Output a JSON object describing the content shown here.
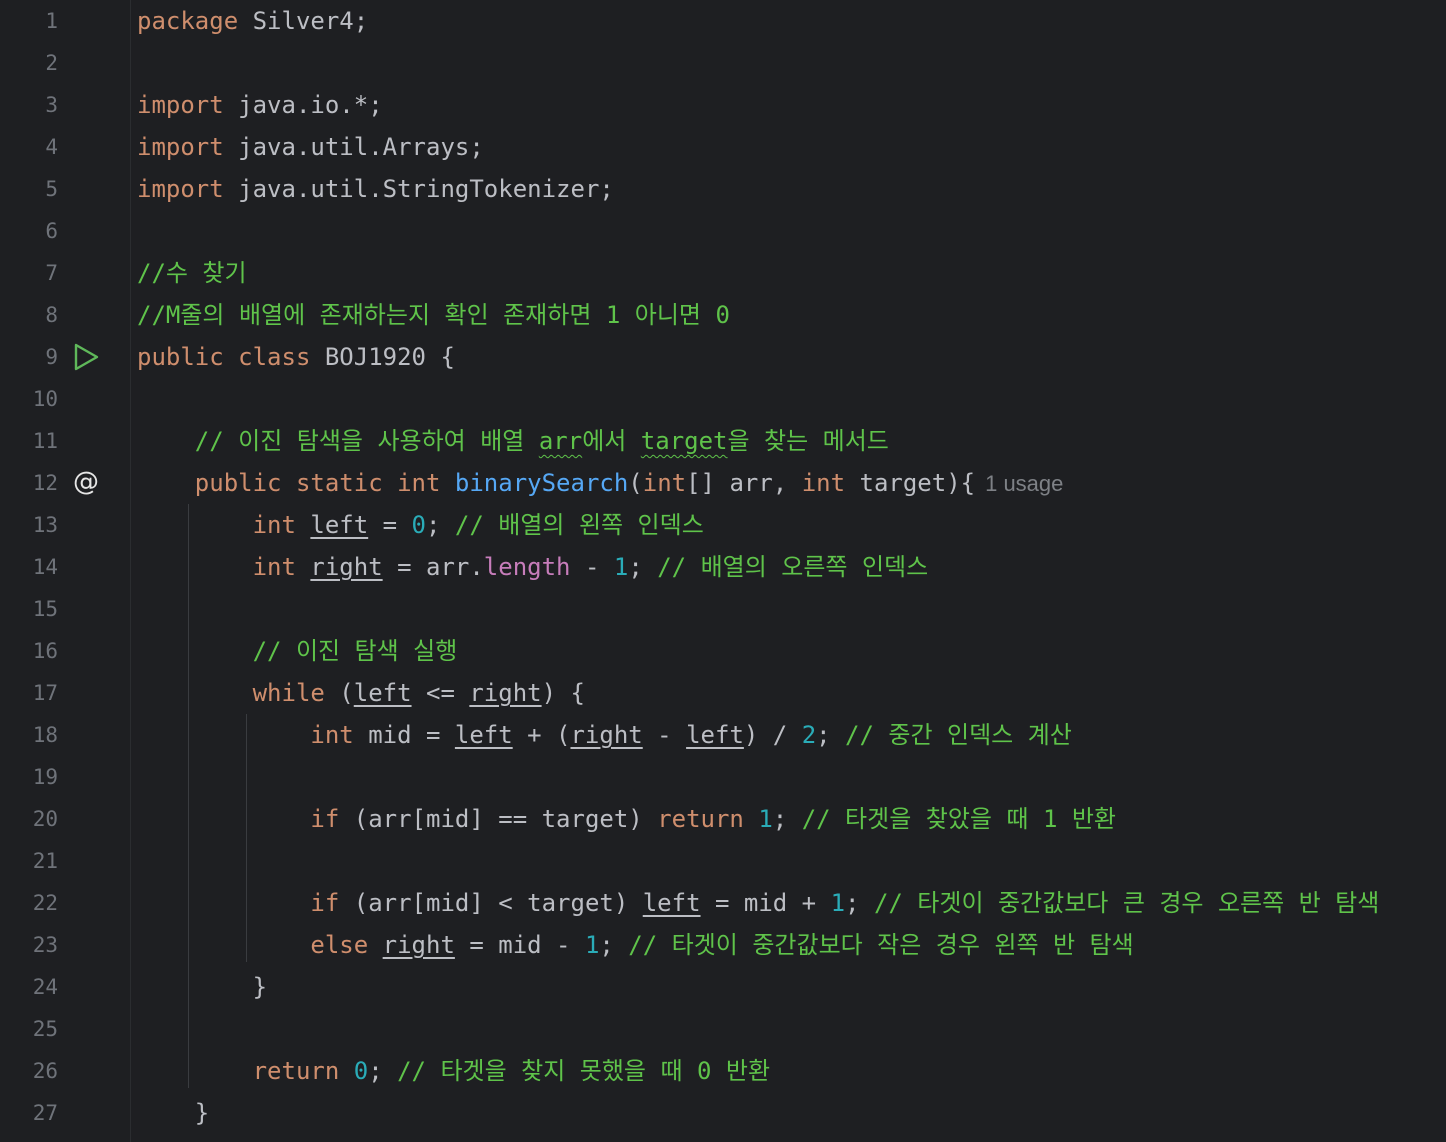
{
  "editor": {
    "lines": [
      {
        "n": "1",
        "tokens": [
          {
            "t": "package ",
            "c": "kw"
          },
          {
            "t": "Silver4;",
            "c": "pl"
          }
        ]
      },
      {
        "n": "2",
        "tokens": []
      },
      {
        "n": "3",
        "tokens": [
          {
            "t": "import ",
            "c": "kw"
          },
          {
            "t": "java.io.*;",
            "c": "pl"
          }
        ]
      },
      {
        "n": "4",
        "tokens": [
          {
            "t": "import ",
            "c": "kw"
          },
          {
            "t": "java.util.Arrays;",
            "c": "pl"
          }
        ]
      },
      {
        "n": "5",
        "tokens": [
          {
            "t": "import ",
            "c": "kw"
          },
          {
            "t": "java.util.StringTokenizer;",
            "c": "pl"
          }
        ]
      },
      {
        "n": "6",
        "tokens": []
      },
      {
        "n": "7",
        "tokens": [
          {
            "t": "//수 찾기",
            "c": "cm"
          }
        ]
      },
      {
        "n": "8",
        "tokens": [
          {
            "t": "//M줄의 배열에 존재하는지 확인 존재하면 1 아니면 0",
            "c": "cm"
          }
        ]
      },
      {
        "n": "9",
        "icon": "run",
        "tokens": [
          {
            "t": "public ",
            "c": "kw"
          },
          {
            "t": "class ",
            "c": "kw"
          },
          {
            "t": "BOJ1920 {",
            "c": "pl"
          }
        ]
      },
      {
        "n": "10",
        "tokens": []
      },
      {
        "n": "11",
        "tokens": [
          {
            "t": "    // 이진 탐색을 사용하여 배열 ",
            "c": "cm"
          },
          {
            "t": "arr",
            "c": "typo"
          },
          {
            "t": "에서 ",
            "c": "cm"
          },
          {
            "t": "target",
            "c": "typo"
          },
          {
            "t": "을 찾는 메서드",
            "c": "cm"
          }
        ]
      },
      {
        "n": "12",
        "icon": "override",
        "tokens": [
          {
            "t": "    public ",
            "c": "kw"
          },
          {
            "t": "static ",
            "c": "kw"
          },
          {
            "t": "int ",
            "c": "kw"
          },
          {
            "t": "binarySearch",
            "c": "fn"
          },
          {
            "t": "(",
            "c": "pl"
          },
          {
            "t": "int",
            "c": "kw"
          },
          {
            "t": "[] arr, ",
            "c": "pl"
          },
          {
            "t": "int ",
            "c": "kw"
          },
          {
            "t": "target){",
            "c": "pl"
          },
          {
            "t": "1 usage",
            "c": "hint"
          }
        ]
      },
      {
        "n": "13",
        "tokens": [
          {
            "t": "        ",
            "c": "pl"
          },
          {
            "t": "int ",
            "c": "kw"
          },
          {
            "t": "left",
            "c": "var"
          },
          {
            "t": " = ",
            "c": "pl"
          },
          {
            "t": "0",
            "c": "num"
          },
          {
            "t": "; ",
            "c": "pl"
          },
          {
            "t": "// 배열의 왼쪽 인덱스",
            "c": "cm"
          }
        ]
      },
      {
        "n": "14",
        "tokens": [
          {
            "t": "        ",
            "c": "pl"
          },
          {
            "t": "int ",
            "c": "kw"
          },
          {
            "t": "right",
            "c": "var"
          },
          {
            "t": " = arr.",
            "c": "pl"
          },
          {
            "t": "length",
            "c": "fld"
          },
          {
            "t": " - ",
            "c": "pl"
          },
          {
            "t": "1",
            "c": "num"
          },
          {
            "t": "; ",
            "c": "pl"
          },
          {
            "t": "// 배열의 오른쪽 인덱스",
            "c": "cm"
          }
        ]
      },
      {
        "n": "15",
        "tokens": []
      },
      {
        "n": "16",
        "tokens": [
          {
            "t": "        // 이진 탐색 실행",
            "c": "cm"
          }
        ]
      },
      {
        "n": "17",
        "tokens": [
          {
            "t": "        while ",
            "c": "kw"
          },
          {
            "t": "(",
            "c": "pl"
          },
          {
            "t": "left",
            "c": "var"
          },
          {
            "t": " <= ",
            "c": "pl"
          },
          {
            "t": "right",
            "c": "var"
          },
          {
            "t": ") {",
            "c": "pl"
          }
        ]
      },
      {
        "n": "18",
        "tokens": [
          {
            "t": "            ",
            "c": "pl"
          },
          {
            "t": "int ",
            "c": "kw"
          },
          {
            "t": "mid = ",
            "c": "pl"
          },
          {
            "t": "left",
            "c": "var"
          },
          {
            "t": " + (",
            "c": "pl"
          },
          {
            "t": "right",
            "c": "var"
          },
          {
            "t": " - ",
            "c": "pl"
          },
          {
            "t": "left",
            "c": "var"
          },
          {
            "t": ") / ",
            "c": "pl"
          },
          {
            "t": "2",
            "c": "num"
          },
          {
            "t": "; ",
            "c": "pl"
          },
          {
            "t": "// 중간 인덱스 계산",
            "c": "cm"
          }
        ]
      },
      {
        "n": "19",
        "tokens": []
      },
      {
        "n": "20",
        "tokens": [
          {
            "t": "            if ",
            "c": "kw"
          },
          {
            "t": "(arr[mid] == target) ",
            "c": "pl"
          },
          {
            "t": "return ",
            "c": "kw"
          },
          {
            "t": "1",
            "c": "num"
          },
          {
            "t": "; ",
            "c": "pl"
          },
          {
            "t": "// 타겟을 찾았을 때 1 반환",
            "c": "cm"
          }
        ]
      },
      {
        "n": "21",
        "tokens": []
      },
      {
        "n": "22",
        "tokens": [
          {
            "t": "            if ",
            "c": "kw"
          },
          {
            "t": "(arr[mid] < target) ",
            "c": "pl"
          },
          {
            "t": "left",
            "c": "var"
          },
          {
            "t": " = mid + ",
            "c": "pl"
          },
          {
            "t": "1",
            "c": "num"
          },
          {
            "t": "; ",
            "c": "pl"
          },
          {
            "t": "// 타겟이 중간값보다 큰 경우 오른쪽 반 탐색",
            "c": "cm"
          }
        ]
      },
      {
        "n": "23",
        "tokens": [
          {
            "t": "            else ",
            "c": "kw"
          },
          {
            "t": "right",
            "c": "var"
          },
          {
            "t": " = mid - ",
            "c": "pl"
          },
          {
            "t": "1",
            "c": "num"
          },
          {
            "t": "; ",
            "c": "pl"
          },
          {
            "t": "// 타겟이 중간값보다 작은 경우 왼쪽 반 탐색",
            "c": "cm"
          }
        ]
      },
      {
        "n": "24",
        "tokens": [
          {
            "t": "        }",
            "c": "pl"
          }
        ]
      },
      {
        "n": "25",
        "tokens": []
      },
      {
        "n": "26",
        "tokens": [
          {
            "t": "        return ",
            "c": "kw"
          },
          {
            "t": "0",
            "c": "num"
          },
          {
            "t": "; ",
            "c": "pl"
          },
          {
            "t": "// 타겟을 찾지 못했을 때 0 반환",
            "c": "cm"
          }
        ]
      },
      {
        "n": "27",
        "tokens": [
          {
            "t": "    }",
            "c": "pl"
          }
        ]
      }
    ]
  },
  "colors": {
    "background": "#1e1f22",
    "keyword": "#cf8e6d",
    "comment": "#5fc34a",
    "function": "#56a8f5",
    "number": "#2aacb8",
    "field": "#c77dbb",
    "plain": "#bcbec4",
    "line_number": "#6f737a"
  },
  "icons": {
    "run": "run-gutter-icon",
    "override": "implementation-gutter-icon"
  }
}
